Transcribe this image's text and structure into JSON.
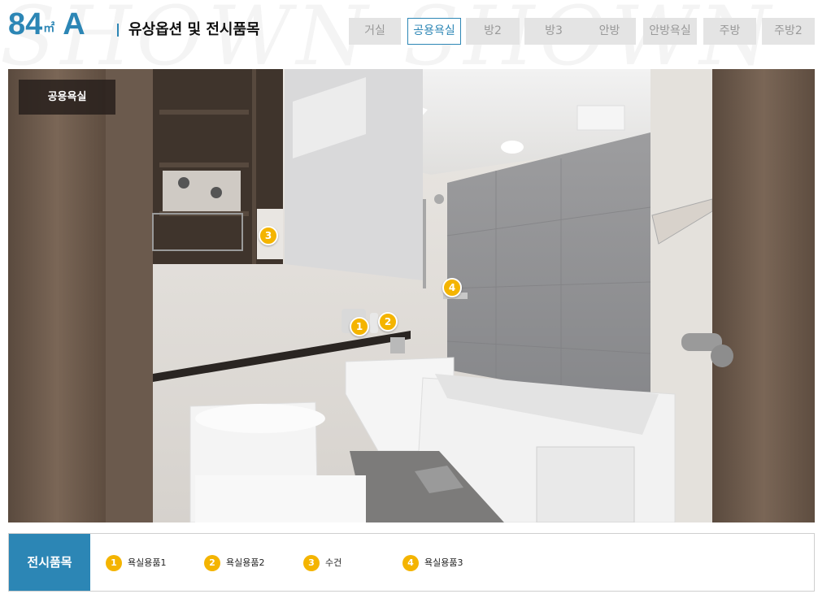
{
  "header": {
    "plan_number": "84",
    "plan_unit": "㎡",
    "plan_type": "A",
    "section_title": "유상옵션 및 전시품목"
  },
  "tabs": [
    {
      "label": "거실",
      "active": false
    },
    {
      "label": "공용욕실",
      "active": true
    },
    {
      "label": "방2",
      "active": false
    },
    {
      "label": "방3",
      "active": false
    },
    {
      "label": "안방",
      "active": false
    },
    {
      "label": "안방욕실",
      "active": false
    },
    {
      "label": "주방",
      "active": false
    },
    {
      "label": "주방2",
      "active": false
    }
  ],
  "scene": {
    "room_label": "공용욕실",
    "markers": [
      "1",
      "2",
      "3",
      "4"
    ]
  },
  "legend": {
    "title": "전시품목",
    "items": [
      {
        "num": "1",
        "label": "욕실용품1"
      },
      {
        "num": "2",
        "label": "욕실용품2"
      },
      {
        "num": "3",
        "label": "수건"
      },
      {
        "num": "4",
        "label": "욕실용품3"
      }
    ]
  },
  "colors": {
    "accent": "#2c86b5",
    "marker": "#f4b400",
    "tab_inactive_bg": "#e4e4e4"
  }
}
